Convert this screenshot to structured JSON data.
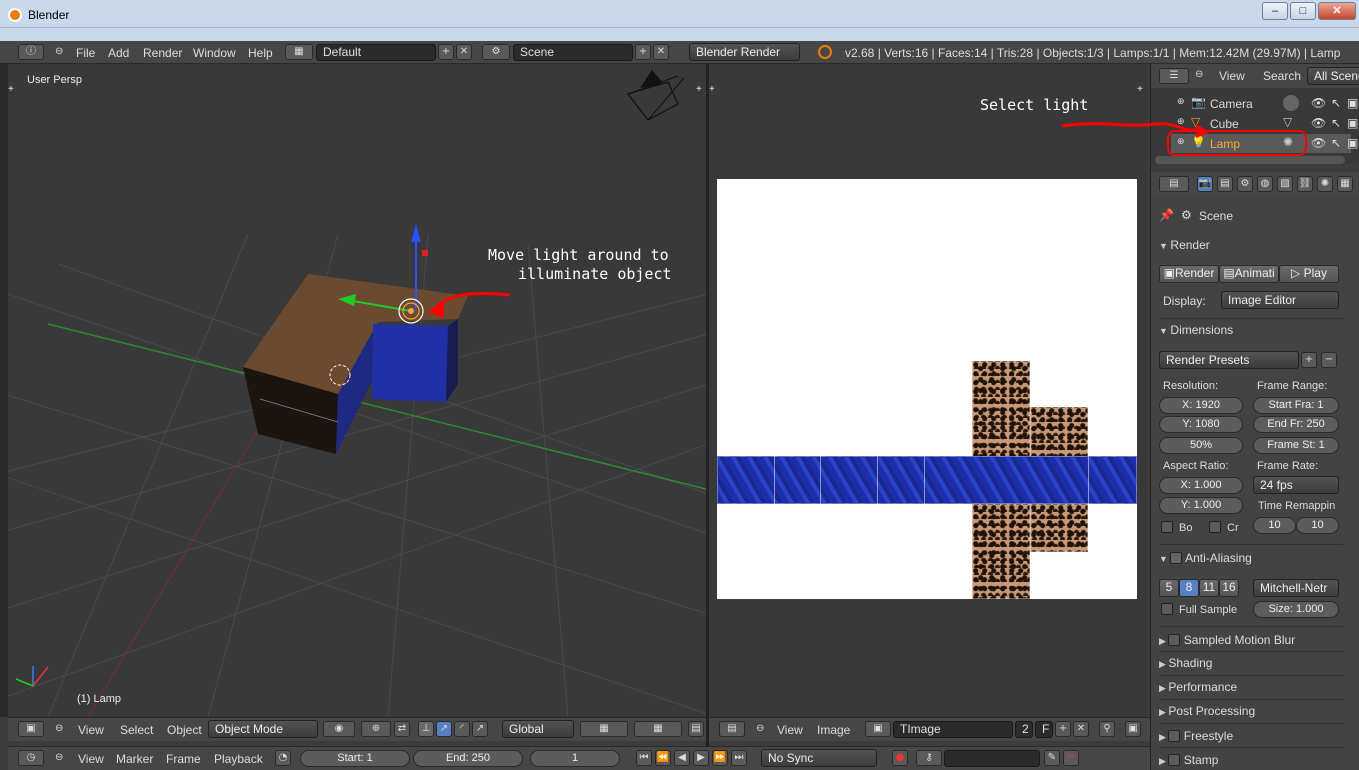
{
  "window": {
    "title": "Blender",
    "min": "–",
    "max": "□",
    "close": "✕"
  },
  "menubar": {
    "items": [
      "File",
      "Add",
      "Render",
      "Window",
      "Help"
    ],
    "layout": "Default",
    "scene": "Scene",
    "engine": "Blender Render",
    "stats": "v2.68 | Verts:16 | Faces:14 | Tris:28 | Objects:1/3 | Lamps:1/1 | Mem:12.42M (29.97M) | Lamp"
  },
  "viewport": {
    "view_label": "User Persp",
    "object_label": "(1) Lamp",
    "annotation": [
      "Move light around to",
      "illuminate object"
    ],
    "header": {
      "items": [
        "View",
        "Select",
        "Object"
      ],
      "mode": "Object Mode",
      "orientation": "Global"
    }
  },
  "image_editor": {
    "header": {
      "items": [
        "View",
        "Image"
      ],
      "image_name": "TImage",
      "users": "2",
      "fake": "F"
    }
  },
  "outliner": {
    "items": [
      "View",
      "Search"
    ],
    "filter": "All Scene",
    "rows": [
      {
        "name": "Camera",
        "icon": "camera-icon"
      },
      {
        "name": "Cube",
        "icon": "mesh-icon"
      },
      {
        "name": "Lamp",
        "icon": "lamp-icon"
      }
    ],
    "annotation": "Select light"
  },
  "properties": {
    "scene_label": "Scene",
    "render": {
      "title": "Render",
      "render_btn": "Render",
      "anim_btn": "Animati",
      "play_btn": "Play",
      "display_label": "Display:",
      "display_value": "Image Editor"
    },
    "dimensions": {
      "title": "Dimensions",
      "presets": "Render Presets",
      "resolution_label": "Resolution:",
      "res_x": "X: 1920",
      "res_y": "Y: 1080",
      "res_pct": "50%",
      "frame_range_label": "Frame Range:",
      "start": "Start Fra: 1",
      "end": "End Fr: 250",
      "step": "Frame St: 1",
      "aspect_label": "Aspect Ratio:",
      "asp_x": "X: 1.000",
      "asp_y": "Y: 1.000",
      "frame_rate_label": "Frame Rate:",
      "fps": "24 fps",
      "time_remap_label": "Time Remappin",
      "remap_old": "10",
      "remap_new": "10",
      "border": "Bo",
      "crop": "Cr"
    },
    "aa": {
      "title": "Anti-Aliasing",
      "samples": [
        "5",
        "8",
        "11",
        "16"
      ],
      "active_sample": "8",
      "filter": "Mitchell-Netr",
      "full_sample": "Full Sample",
      "size": "Size: 1.000"
    },
    "panels": [
      "Sampled Motion Blur",
      "Shading",
      "Performance",
      "Post Processing",
      "Freestyle",
      "Stamp"
    ]
  },
  "timeline": {
    "items": [
      "View",
      "Marker",
      "Frame",
      "Playback"
    ],
    "start": "Start: 1",
    "end": "End: 250",
    "current": "1",
    "sync": "No Sync"
  },
  "colors": {
    "accent": "#5680c2",
    "annotation": "#ff0000"
  }
}
